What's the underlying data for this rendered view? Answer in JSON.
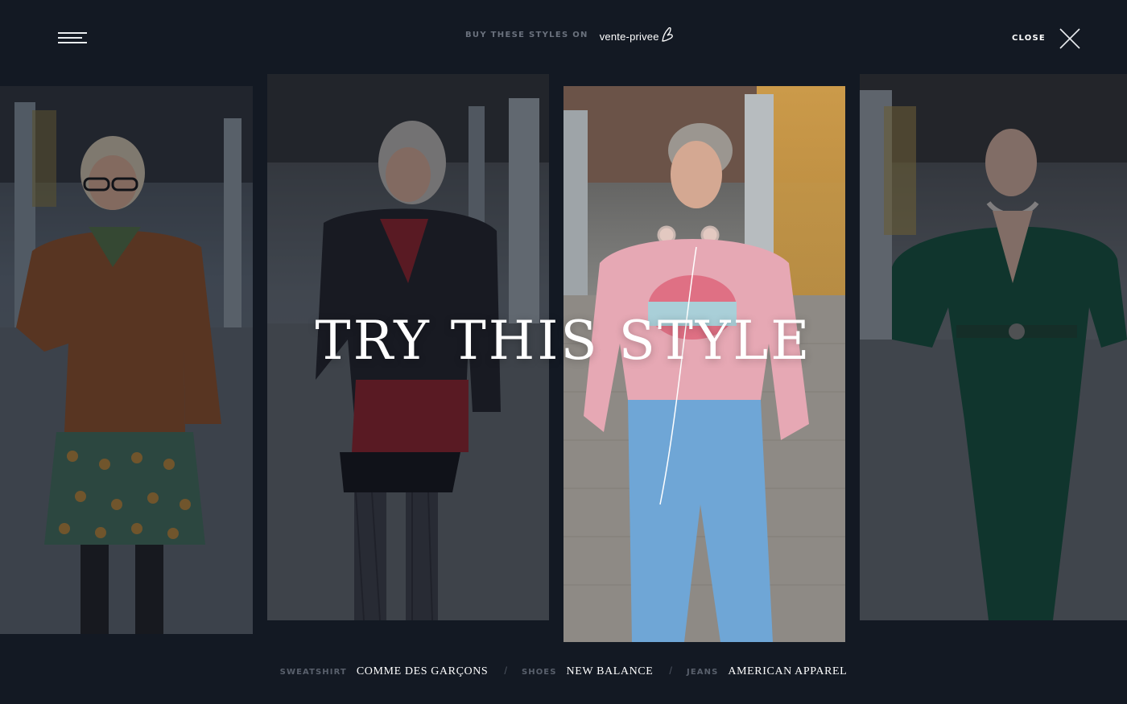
{
  "header": {
    "menu_icon": "hamburger-menu-icon",
    "buy_label": "BUY THESE STYLES ON",
    "brand_name": "vente-privee",
    "close_label": "CLOSE",
    "close_icon": "close-x-icon"
  },
  "hero": {
    "headline": "TRY THIS STYLE"
  },
  "looks": [
    {
      "palette": [
        "#8a4a22",
        "#3f6a55",
        "#c9862e"
      ]
    },
    {
      "palette": [
        "#1d1d22",
        "#8c1d24",
        "#2a2a30"
      ]
    },
    {
      "palette": [
        "#e6a8b4",
        "#6fa6d6",
        "#d6a24a"
      ]
    },
    {
      "palette": [
        "#0f4a34",
        "#173f2c",
        "#caa"
      ]
    }
  ],
  "credits": [
    {
      "label": "SWEATSHIRT",
      "value": "COMME DES GARÇONS"
    },
    {
      "label": "SHOES",
      "value": "NEW BALANCE"
    },
    {
      "label": "JEANS",
      "value": "AMERICAN APPAREL"
    }
  ],
  "separator": "/",
  "colors": {
    "background": "#131923",
    "muted_text": "#59606c"
  }
}
